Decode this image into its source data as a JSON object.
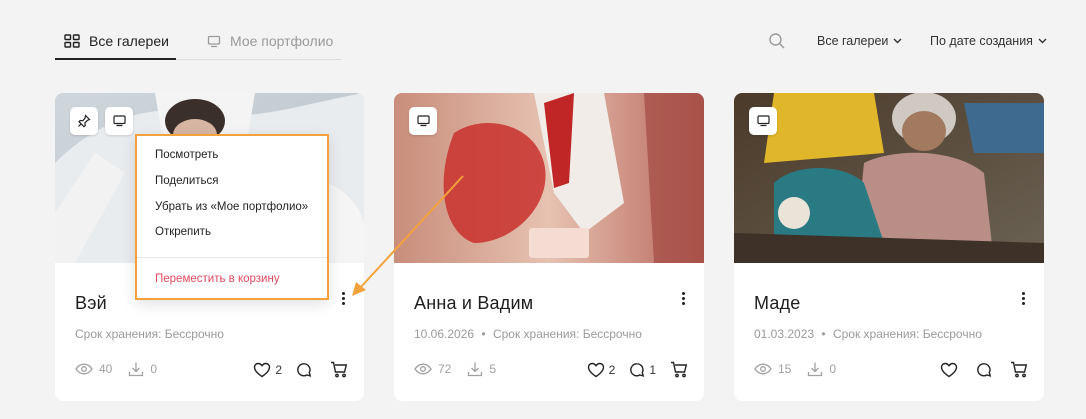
{
  "tabs": [
    {
      "label": "Все галереи",
      "icon": "grid-icon",
      "active": true
    },
    {
      "label": "Мое портфолио",
      "icon": "monitor-icon",
      "active": false
    }
  ],
  "toolbar": {
    "search_icon": "search-icon",
    "filter_label": "Все галереи",
    "sort_label": "По дате создания"
  },
  "cards": [
    {
      "title": "Вэй",
      "date": "",
      "storage": "Срок хранения: Бессрочно",
      "views": "40",
      "downloads": "0",
      "likes": "2",
      "comments": "",
      "pinned": true
    },
    {
      "title": "Анна и Вадим",
      "date": "10.06.2026",
      "storage": "Срок хранения: Бессрочно",
      "views": "72",
      "downloads": "5",
      "likes": "2",
      "comments": "1",
      "pinned": false
    },
    {
      "title": "Маде",
      "date": "01.03.2023",
      "storage": "Срок хранения: Бессрочно",
      "views": "15",
      "downloads": "0",
      "likes": "",
      "comments": "",
      "pinned": false
    }
  ],
  "meta_separator": "•",
  "context_menu": {
    "items": [
      "Посмотреть",
      "Поделиться",
      "Убрать из «Мое портфолио»",
      "Открепить"
    ],
    "danger_item": "Переместить в корзину"
  },
  "colors": {
    "highlight": "#f2a13b",
    "danger": "#e0485d",
    "background": "#f3f3f4"
  }
}
